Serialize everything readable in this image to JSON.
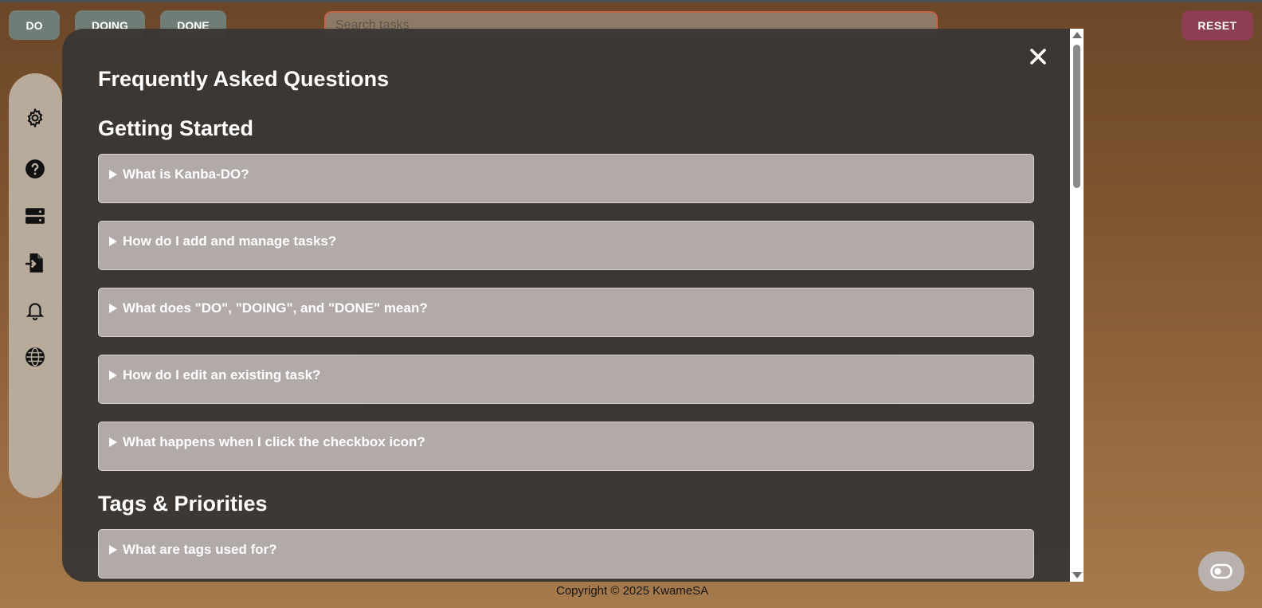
{
  "topbar": {
    "do_label": "DO",
    "doing_label": "DOING",
    "done_label": "DONE",
    "search_placeholder": "Search tasks",
    "reset_label": "RESET"
  },
  "sidebar": {
    "items": [
      {
        "icon": "gear-icon"
      },
      {
        "icon": "help-icon"
      },
      {
        "icon": "storage-icon"
      },
      {
        "icon": "import-icon"
      },
      {
        "icon": "bell-icon"
      },
      {
        "icon": "globe-icon"
      }
    ]
  },
  "faq_modal": {
    "title": "Frequently Asked Questions",
    "close_label": "✕",
    "sections": [
      {
        "title": "Getting Started",
        "questions": [
          "What is Kanba-DO?",
          "How do I add and manage tasks?",
          "What does \"DO\", \"DOING\", and \"DONE\" mean?",
          "How do I edit an existing task?",
          "What happens when I click the checkbox icon?"
        ]
      },
      {
        "title": "Tags & Priorities",
        "questions": [
          "What are tags used for?"
        ]
      }
    ]
  },
  "footer": {
    "text": "Copyright © 2025  KwameSA"
  },
  "colors": {
    "modal_bg": "#3a3634",
    "faq_item_bg": "#b1aaa9",
    "reset_bg": "#8c3f52",
    "status_btn_bg": "#6f7d76"
  }
}
